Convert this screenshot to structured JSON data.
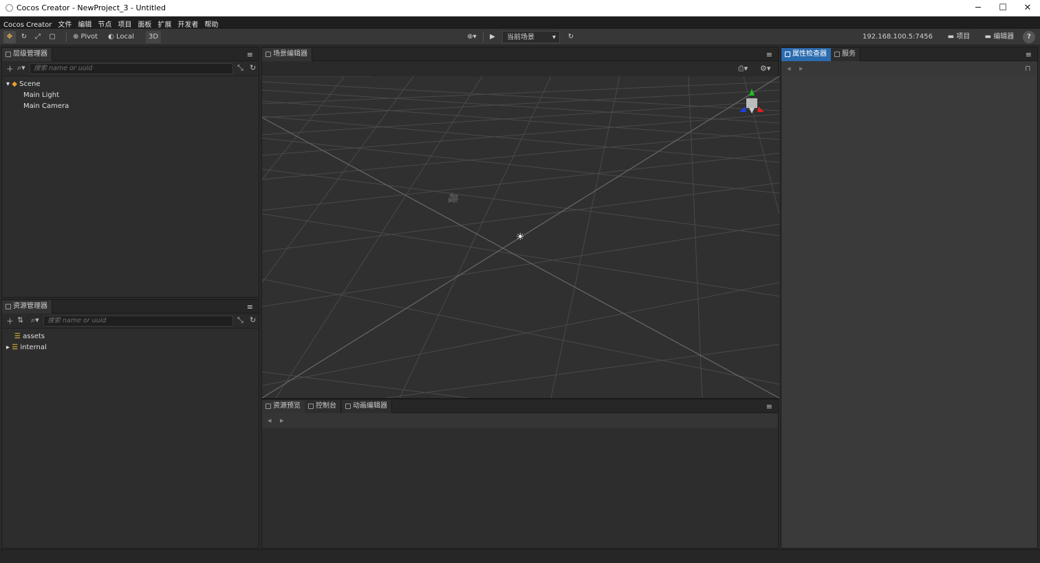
{
  "window": {
    "title": "Cocos Creator - NewProject_3 - Untitled",
    "min": "─",
    "max": "☐",
    "close": "✕"
  },
  "menu": [
    "Cocos Creator",
    "文件",
    "编辑",
    "节点",
    "项目",
    "面板",
    "扩展",
    "开发者",
    "帮助"
  ],
  "toolbar": {
    "pivot": "Pivot",
    "local": "Local",
    "mode3d": "3D",
    "scene_select": "当前场景",
    "ip": "192.168.100.5:7456",
    "project_btn": "项目",
    "editor_btn": "编辑器",
    "help": "?"
  },
  "hierarchy": {
    "tab": "层级管理器",
    "search_placeholder": "搜索 name or uuid",
    "nodes": [
      "Scene",
      "Main Light",
      "Main Camera"
    ]
  },
  "assets": {
    "tab": "资源管理器",
    "search_placeholder": "搜索 name or uuid",
    "items": [
      "assets",
      "internal"
    ]
  },
  "scene_editor": {
    "tab": "场景编辑器"
  },
  "bottom_panel": {
    "tabs": [
      "资源预览",
      "控制台",
      "动画编辑器"
    ]
  },
  "inspector": {
    "tabs": [
      "属性检查器",
      "服务"
    ]
  },
  "colors": {
    "accent": "#2b6cb0",
    "gizmo_x": "#e02020",
    "gizmo_y": "#20c020",
    "gizmo_z": "#2040e0"
  }
}
